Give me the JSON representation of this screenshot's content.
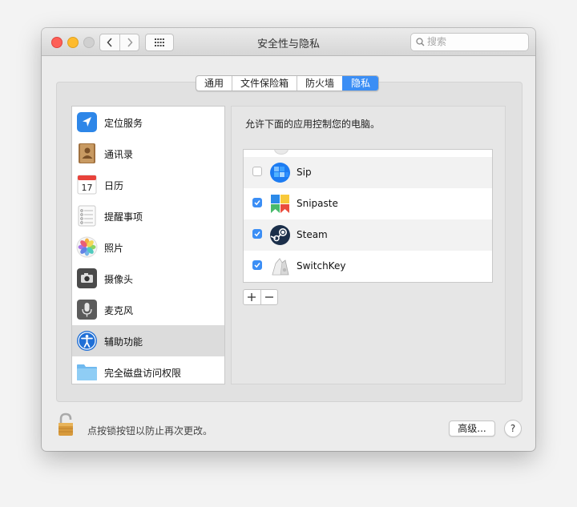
{
  "window": {
    "title": "安全性与隐私",
    "search_placeholder": "搜索"
  },
  "tabs": [
    {
      "label": "通用",
      "active": false
    },
    {
      "label": "文件保险箱",
      "active": false
    },
    {
      "label": "防火墙",
      "active": false
    },
    {
      "label": "隐私",
      "active": true
    }
  ],
  "sidebar": {
    "items": [
      {
        "label": "定位服务",
        "icon": "location-arrow-icon",
        "selected": false
      },
      {
        "label": "通讯录",
        "icon": "contacts-book-icon",
        "selected": false
      },
      {
        "label": "日历",
        "icon": "calendar-icon",
        "selected": false,
        "icon_text": "17"
      },
      {
        "label": "提醒事项",
        "icon": "reminders-icon",
        "selected": false
      },
      {
        "label": "照片",
        "icon": "photos-flower-icon",
        "selected": false
      },
      {
        "label": "摄像头",
        "icon": "camera-icon",
        "selected": false
      },
      {
        "label": "麦克风",
        "icon": "microphone-icon",
        "selected": false
      },
      {
        "label": "辅助功能",
        "icon": "accessibility-icon",
        "selected": true
      },
      {
        "label": "完全磁盘访问权限",
        "icon": "folder-icon",
        "selected": false
      }
    ]
  },
  "main": {
    "heading": "允许下面的应用控制您的电脑。",
    "apps": [
      {
        "name": "Sip",
        "checked": false,
        "icon": "sip-app-icon"
      },
      {
        "name": "Snipaste",
        "checked": true,
        "icon": "snipaste-app-icon"
      },
      {
        "name": "Steam",
        "checked": true,
        "icon": "steam-app-icon"
      },
      {
        "name": "SwitchKey",
        "checked": true,
        "icon": "switchkey-app-icon"
      }
    ],
    "add_label": "+",
    "remove_label": "−"
  },
  "footer": {
    "lock_text": "点按锁按钮以防止再次更改。",
    "advanced_label": "高级...",
    "help_label": "?"
  },
  "colors": {
    "accent": "#3b8ef5",
    "selected_row": "#dcdcdc",
    "close": "#fd5f57",
    "minimize": "#febb2e"
  }
}
